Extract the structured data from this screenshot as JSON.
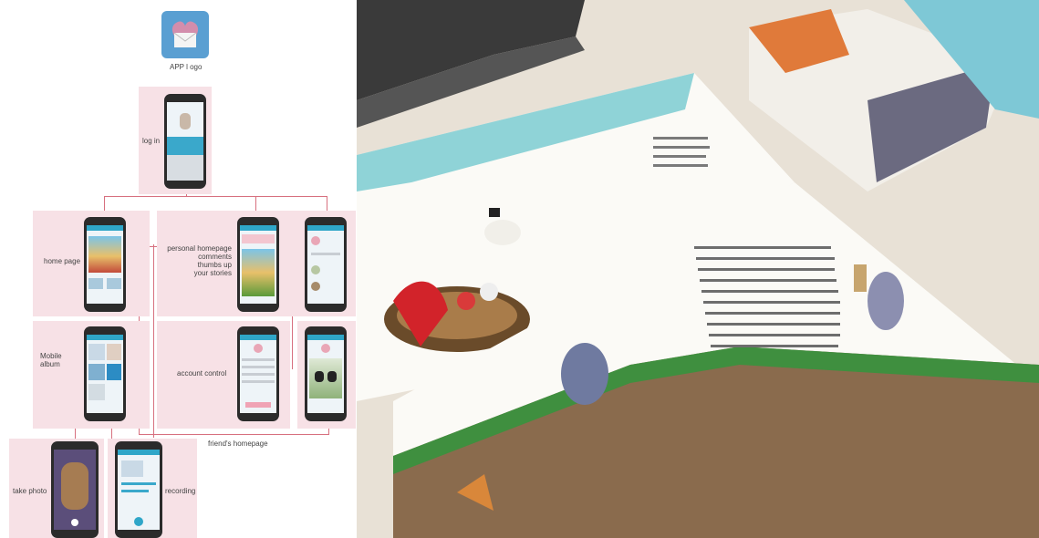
{
  "diagram": {
    "app_logo_label": "APP l ogo",
    "login_label": "log in",
    "home_label": "home page",
    "personal_label": "personal homepage\ncomments\nthumbs up\nyour stories",
    "album_label": "Mobile\nalbum",
    "account_label": "account control",
    "friend_label": "friend's homepage",
    "photo_label": "take photo",
    "recording_label": "recording"
  },
  "colors": {
    "panel": "#f7e1e6",
    "connector": "#d7707f",
    "app_bar": "#2fa6c8",
    "logo_bg": "#5a9fd2"
  }
}
